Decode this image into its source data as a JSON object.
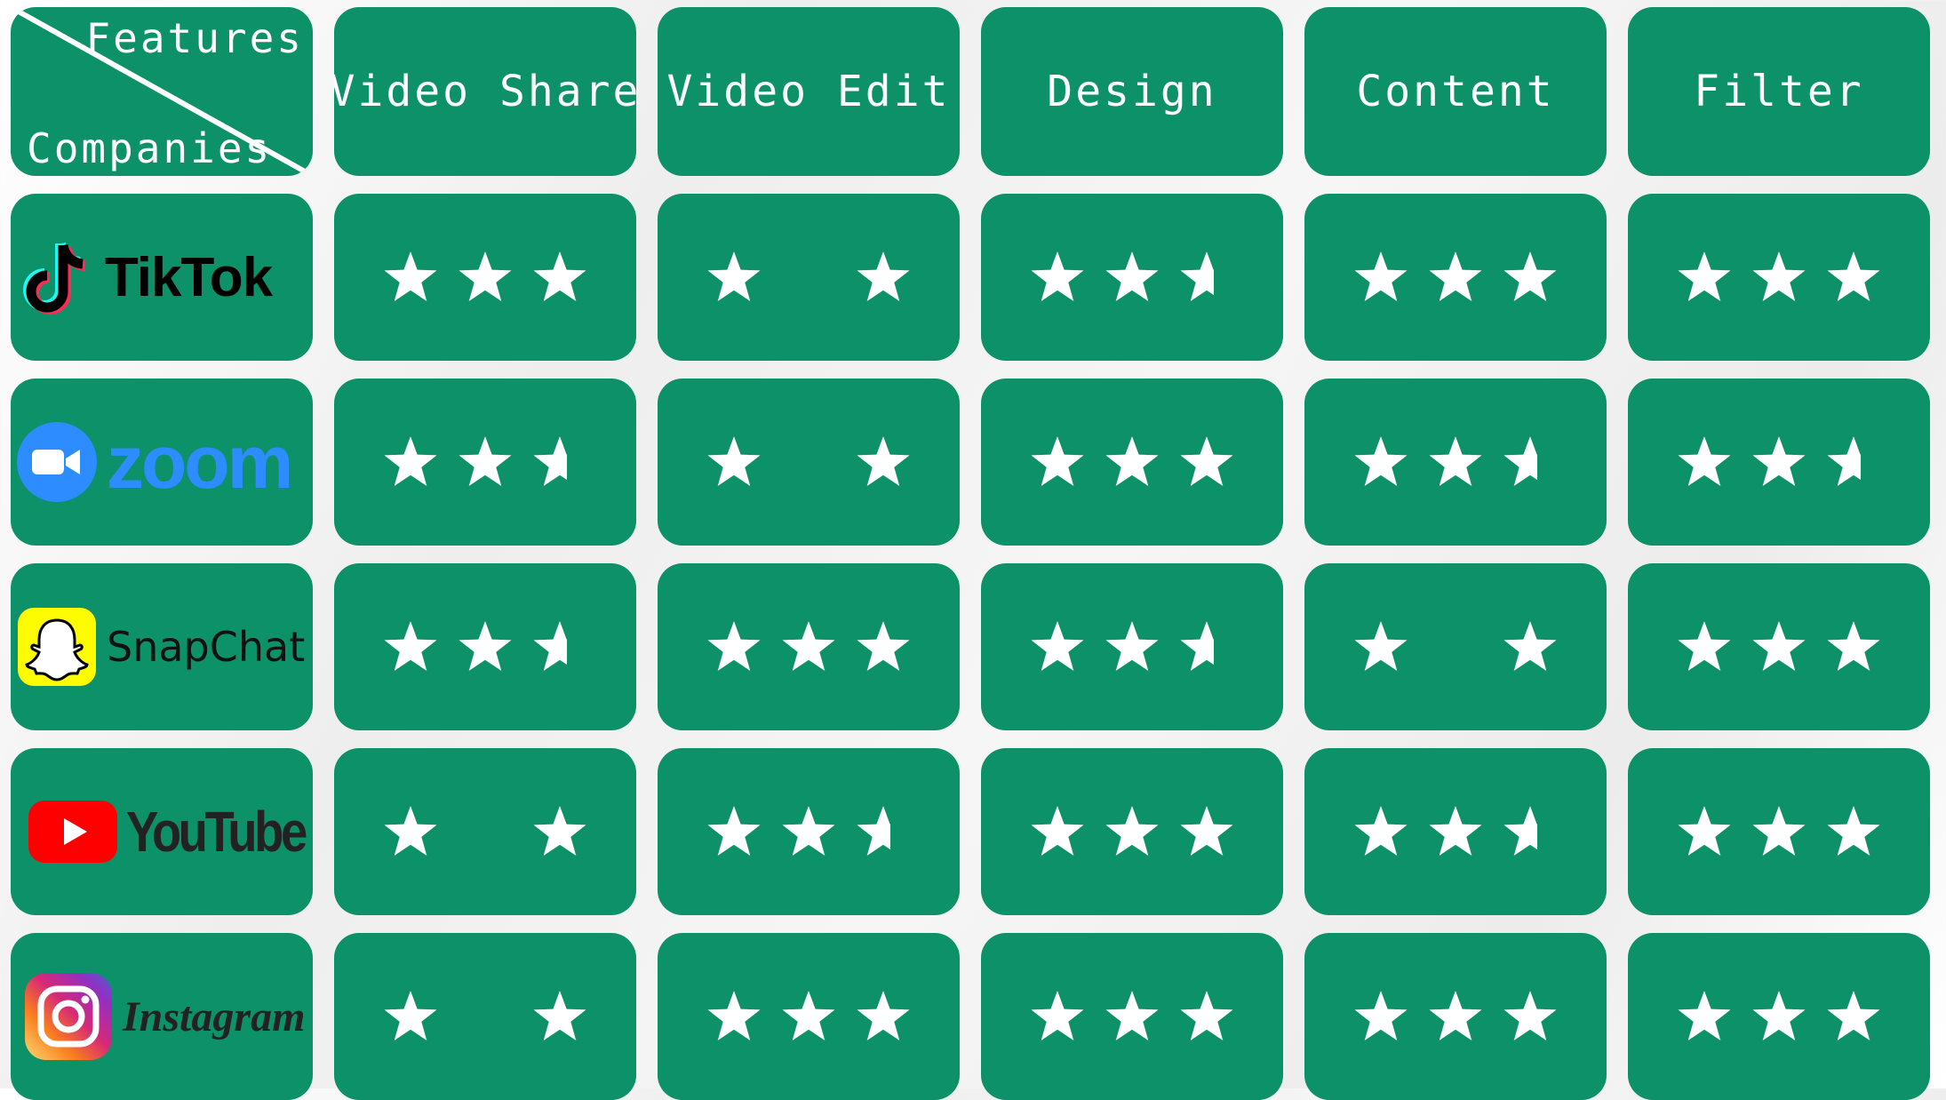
{
  "header": {
    "corner_top": "Features",
    "corner_bottom": "Companies",
    "features": [
      "Video Share",
      "Video Edit",
      "Design",
      "Content",
      "Filter"
    ]
  },
  "colors": {
    "cell": "#0c9168",
    "star": "#ffffff"
  },
  "companies": [
    {
      "name": "TikTok",
      "icon": "tiktok-logo-icon",
      "ratings": [
        3,
        2,
        2.5,
        3,
        3
      ]
    },
    {
      "name": "zoom",
      "icon": "zoom-logo-icon",
      "ratings": [
        2.5,
        2,
        3,
        2.5,
        2.5
      ]
    },
    {
      "name": "SnapChat",
      "icon": "snapchat-logo-icon",
      "ratings": [
        2.5,
        3,
        2.5,
        2,
        3
      ]
    },
    {
      "name": "YouTube",
      "icon": "youtube-logo-icon",
      "ratings": [
        2,
        2.5,
        3,
        2.5,
        3
      ]
    },
    {
      "name": "Instagram",
      "icon": "instagram-logo-icon",
      "ratings": [
        2,
        3,
        3,
        3,
        3
      ]
    }
  ]
}
